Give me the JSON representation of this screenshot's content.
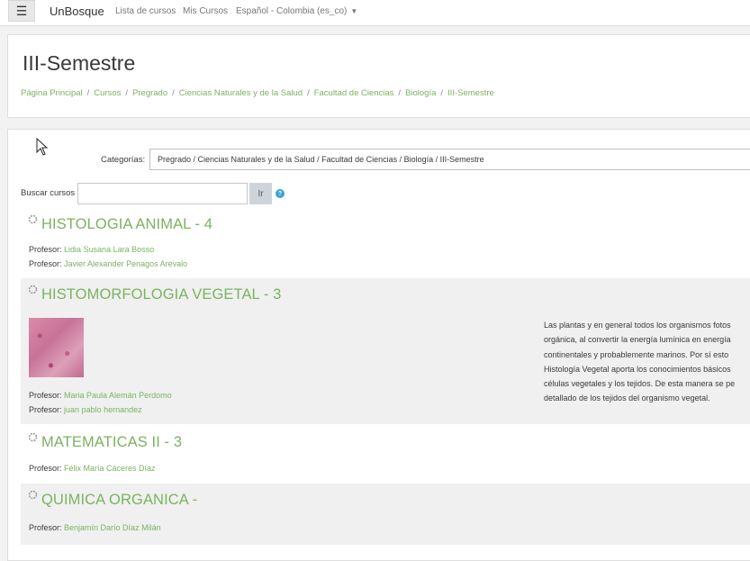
{
  "navbar": {
    "brand": "UnBosque",
    "links": [
      "Lista de cursos",
      "Mis Cursos"
    ],
    "language": "Español - Colombia (es_co)",
    "icons": {
      "menu": "hamburger-menu-icon",
      "language_caret": "caret-down-icon"
    }
  },
  "header": {
    "title": "III-Semestre",
    "breadcrumb": [
      "Página Principal",
      "Cursos",
      "Pregrado",
      "Ciencias Naturales y de la Salud",
      "Facultad de Ciencias",
      "Biología",
      "III-Semestre"
    ]
  },
  "filters": {
    "category_label": "Categorías:",
    "category_value": "Pregrado / Ciencias Naturales y de la Salud / Facultad de Ciencias / Biología / III-Semestre",
    "search_label": "Buscar cursos",
    "search_value": "",
    "search_button": "Ir",
    "help_icon": "?"
  },
  "courses": [
    {
      "name": "HISTOLOGIA ANIMAL - 4",
      "teachers": [
        {
          "role": "Profesor:",
          "name": "Lidia Susana Lara Bosso"
        },
        {
          "role": "Profesor:",
          "name": "Javier Alexander Penagos Arevalo"
        }
      ]
    },
    {
      "name": "HISTOMORFOLOGIA VEGETAL - 3",
      "teachers": [
        {
          "role": "Profesor:",
          "name": "Maria Paula Alemán Perdomo"
        },
        {
          "role": "Profesor:",
          "name": "juan pablo hernandez"
        }
      ],
      "summary_lines": [
        "Las plantas y en general todos los organismos fotos",
        "orgánica, al convertir la energía lumínica en energía",
        "continentales y probablemente marinos. Por sí esto",
        "Histología Vegetal aporta los conocimientos básicos",
        "células vegetales y los tejidos. De esta manera se pe",
        "detallado de los tejidos del organismo vegetal."
      ]
    },
    {
      "name": "MATEMATICAS II - 3",
      "teachers": [
        {
          "role": "Profesor:",
          "name": "Félix María Cáceres Díaz"
        }
      ]
    },
    {
      "name": "QUIMICA ORGANICA -",
      "teachers": [
        {
          "role": "Profesor:",
          "name": "Benjamín Darío Díaz Milán"
        }
      ]
    }
  ],
  "colors": {
    "link": "#7ab35f",
    "alt_row": "#f0f0f0",
    "help_icon": "#38a3d6"
  }
}
